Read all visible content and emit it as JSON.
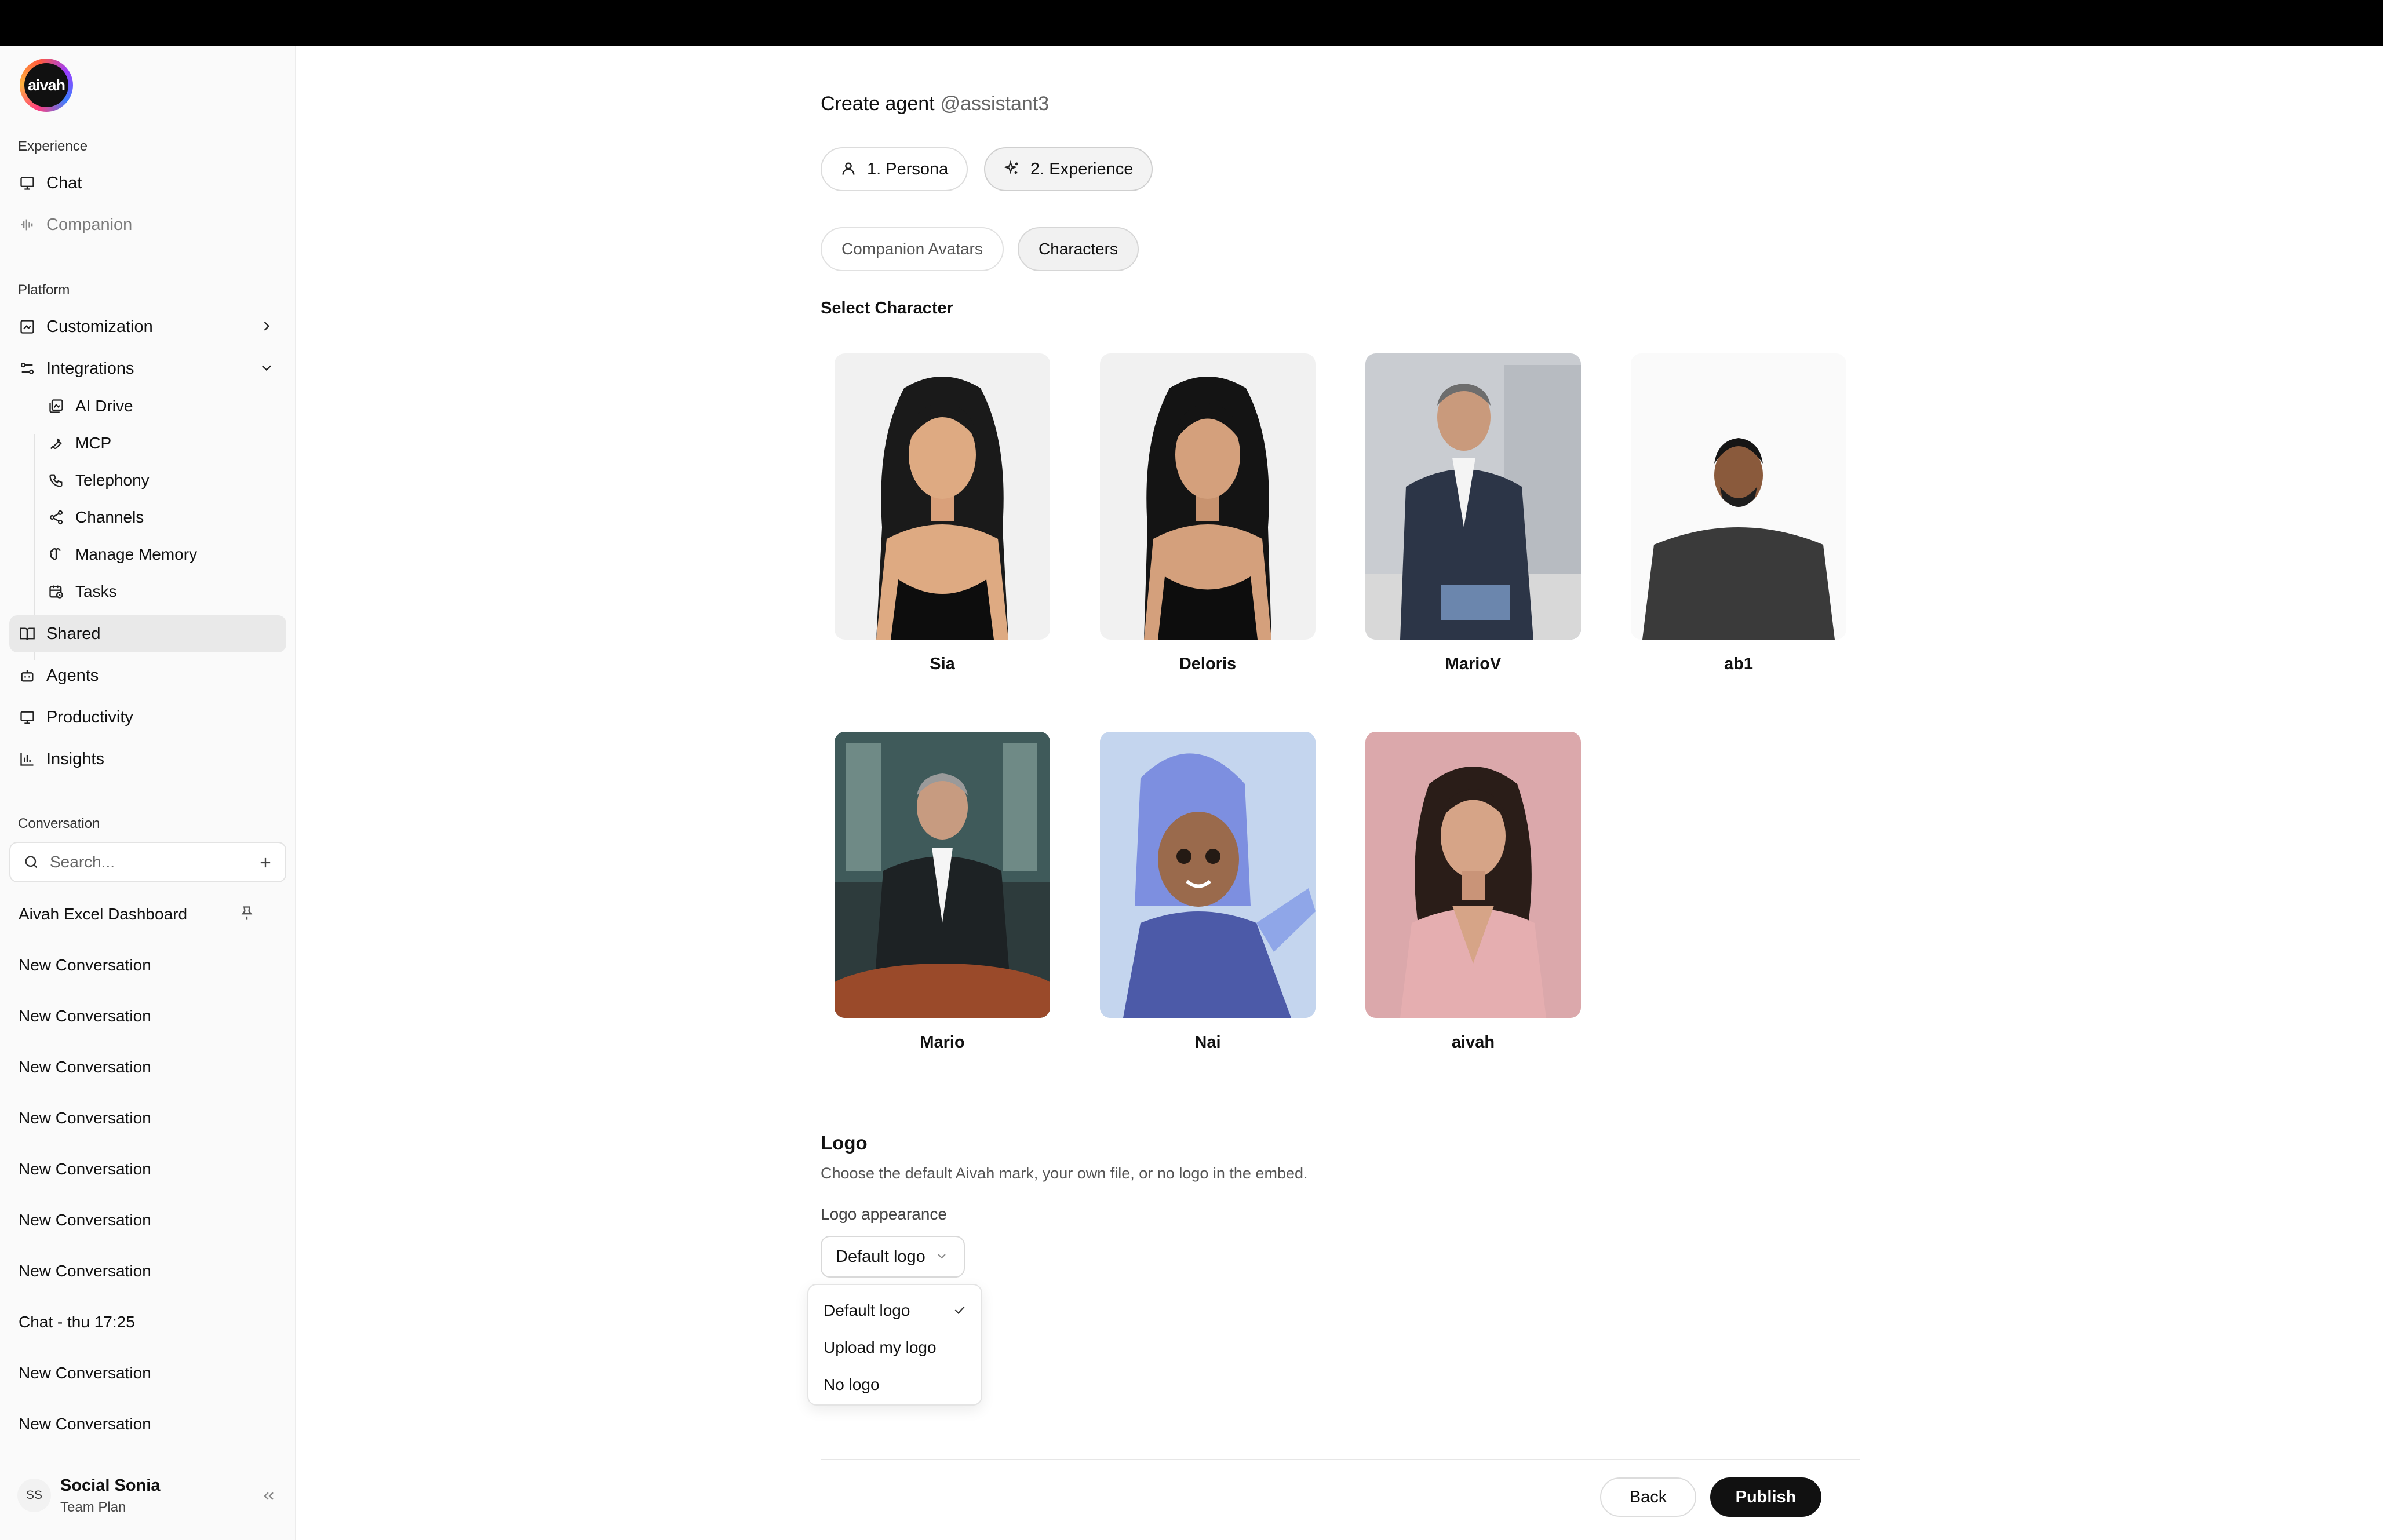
{
  "brand": {
    "logo_text": "aivah"
  },
  "sidebar": {
    "sections": {
      "experience": "Experience",
      "platform": "Platform",
      "conversation": "Conversation"
    },
    "experience_items": [
      {
        "label": "Chat",
        "icon": "chat-icon"
      },
      {
        "label": "Companion",
        "icon": "waveform-icon"
      }
    ],
    "platform_items": [
      {
        "label": "Customization",
        "icon": "customization-icon"
      },
      {
        "label": "Integrations",
        "icon": "integrations-icon"
      }
    ],
    "integrations_sub": [
      {
        "label": "AI Drive",
        "icon": "drive-icon"
      },
      {
        "label": "MCP",
        "icon": "wrench-icon"
      },
      {
        "label": "Telephony",
        "icon": "phone-icon"
      },
      {
        "label": "Channels",
        "icon": "share-icon"
      },
      {
        "label": "Manage Memory",
        "icon": "brain-icon"
      },
      {
        "label": "Tasks",
        "icon": "calendar-clock-icon"
      }
    ],
    "more_items": [
      {
        "label": "Shared",
        "icon": "book-icon"
      },
      {
        "label": "Agents",
        "icon": "bot-icon"
      },
      {
        "label": "Productivity",
        "icon": "monitor-icon"
      },
      {
        "label": "Insights",
        "icon": "bar-chart-icon"
      }
    ],
    "search": {
      "placeholder": "Search..."
    },
    "conversations": [
      "Aivah Excel Dashboard",
      "New Conversation",
      "New Conversation",
      "New Conversation",
      "New Conversation",
      "New Conversation",
      "New Conversation",
      "New Conversation",
      "Chat - thu 17:25",
      "New Conversation",
      "New Conversation"
    ],
    "user": {
      "initials": "SS",
      "name": "Social Sonia",
      "plan": "Team Plan"
    }
  },
  "main": {
    "title": "Create agent",
    "handle": "@assistant3",
    "steps": [
      "1. Persona",
      "2. Experience"
    ],
    "tabs": [
      "Companion Avatars",
      "Characters"
    ],
    "select_title": "Select Character",
    "characters": [
      "Sia",
      "Deloris",
      "MarioV",
      "ab1",
      "Mario",
      "Nai",
      "aivah"
    ],
    "logo": {
      "heading": "Logo",
      "description": "Choose the default Aivah mark, your own file, or no logo in the embed.",
      "label": "Logo appearance",
      "selected": "Default logo",
      "options": [
        "Default logo",
        "Upload my logo",
        "No logo"
      ]
    },
    "footer": {
      "back": "Back",
      "publish": "Publish"
    }
  },
  "colors": {
    "accent": "#111111",
    "active_bg": "#e9e9e9",
    "topbar": "#000000"
  }
}
